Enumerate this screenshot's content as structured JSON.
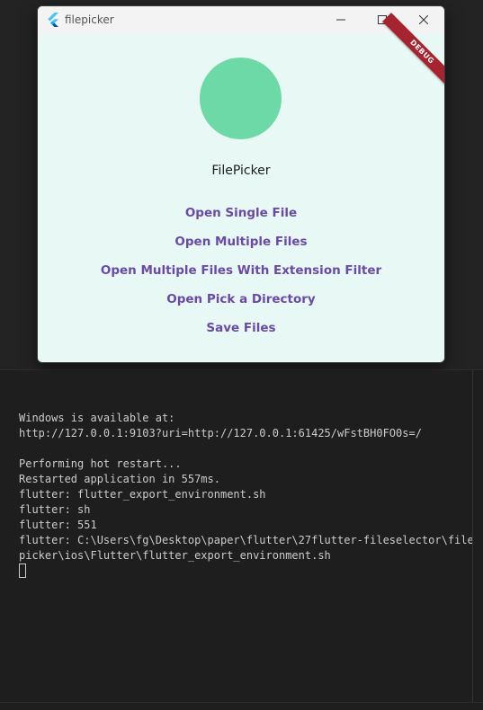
{
  "window": {
    "title": "filepicker",
    "controls": {
      "minimize_icon": "minimize-icon",
      "maximize_icon": "maximize-icon",
      "close_icon": "close-icon"
    }
  },
  "app": {
    "debug_banner": "DEBUG",
    "avatar_color": "#6dd9a6",
    "name": "FilePicker",
    "actions": [
      "Open Single File",
      "Open Multiple Files",
      "Open Multiple Files With Extension Filter",
      "Open Pick a Directory",
      "Save Files"
    ],
    "link_color": "#6a4aa6"
  },
  "terminal": {
    "lines": [
      "Windows is available at:",
      "http://127.0.0.1:9103?uri=http://127.0.0.1:61425/wFstBH0FO0s=/",
      "",
      "Performing hot restart...",
      "Restarted application in 557ms.",
      "flutter: flutter_export_environment.sh",
      "flutter: sh",
      "flutter: 551",
      "flutter: C:\\Users\\fg\\Desktop\\paper\\flutter\\27flutter-fileselector\\file",
      "picker\\ios\\Flutter\\flutter_export_environment.sh"
    ]
  }
}
